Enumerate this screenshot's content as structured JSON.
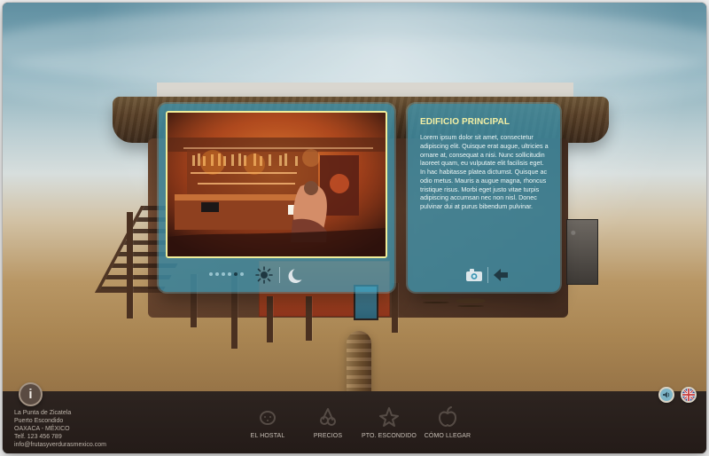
{
  "scene": {
    "title": "EDIFICIO PRINCIPAL",
    "description": "Lorem ipsum dolor sit amet, consectetur adipiscing elit. Quisque erat augue, ultricies a ornare at, consequat a nisi. Nunc sollicitudin laoreet quam, eu vulputate elit facilisis eget. In hac habitasse platea dictumst. Quisque ac odio metus. Mauris a augue magna, rhoncus tristique risus. Morbi eget justo vitae turpis adipiscing accumsan nec non nisl. Donec pulvinar dui at purus bibendum pulvinar."
  },
  "gallery": {
    "dot_count": 6,
    "active_dot_index": 4
  },
  "contact": {
    "lines": [
      "La Punta de Zicatela",
      "Puerto Escondido",
      "OAXACA - MÉXICO",
      "Telf. 123 456 789",
      "info@frutasyverdurasmexico.com"
    ]
  },
  "navigation": {
    "items": [
      {
        "label": "EL HOSTAL",
        "icon": "coconut-icon"
      },
      {
        "label": "PRECIOS",
        "icon": "cherries-icon"
      },
      {
        "label": "PTO. ESCONDIDO",
        "icon": "starfruit-icon"
      },
      {
        "label": "CÓMO LLEGAR",
        "icon": "apple-icon"
      }
    ]
  },
  "controls": {
    "info": "i",
    "language": "uk-flag-icon",
    "volume": "volume-icon",
    "day": "sun-icon",
    "night": "moon-icon",
    "camera": "camera-icon",
    "back": "arrow-left-icon"
  },
  "colors": {
    "accent": "#2ea7cd",
    "panel": "#3d9bb9",
    "title": "#f4f0a5",
    "footer": "#2b201e"
  }
}
